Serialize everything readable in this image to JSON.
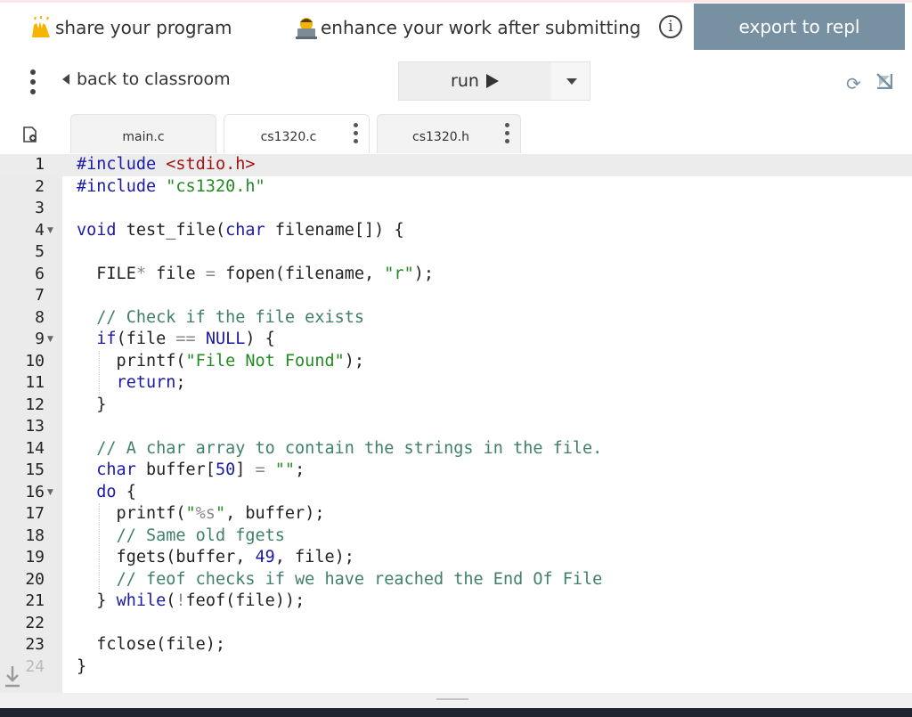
{
  "topbar": {
    "share_label": "share your program",
    "share_icon": "raising-hands-emoji",
    "enhance_label": "enhance your work after submitting",
    "enhance_icon": "person-with-laptop-emoji",
    "info_icon_glyph": "i",
    "export_label": "export to repl",
    "export_color": "#7791a3"
  },
  "toolbar": {
    "back_label": "back to classroom",
    "run_label": "run",
    "refresh_glyph": "⟳"
  },
  "tabs": [
    {
      "label": "main.c"
    },
    {
      "label": "cs1320.c"
    },
    {
      "label": "cs1320.h"
    }
  ],
  "editor": {
    "highlighted_line": 1,
    "lines": [
      {
        "n": "1",
        "fold": false
      },
      {
        "n": "2",
        "fold": false
      },
      {
        "n": "3",
        "fold": false
      },
      {
        "n": "4",
        "fold": true
      },
      {
        "n": "5",
        "fold": false
      },
      {
        "n": "6",
        "fold": false
      },
      {
        "n": "7",
        "fold": false
      },
      {
        "n": "8",
        "fold": false
      },
      {
        "n": "9",
        "fold": true
      },
      {
        "n": "10",
        "fold": false
      },
      {
        "n": "11",
        "fold": false
      },
      {
        "n": "12",
        "fold": false
      },
      {
        "n": "13",
        "fold": false
      },
      {
        "n": "14",
        "fold": false
      },
      {
        "n": "15",
        "fold": false
      },
      {
        "n": "16",
        "fold": true
      },
      {
        "n": "17",
        "fold": false
      },
      {
        "n": "18",
        "fold": false
      },
      {
        "n": "19",
        "fold": false
      },
      {
        "n": "20",
        "fold": false
      },
      {
        "n": "21",
        "fold": false
      },
      {
        "n": "22",
        "fold": false
      },
      {
        "n": "23",
        "fold": false
      },
      {
        "n": "24",
        "fold": false
      }
    ],
    "code": [
      [
        [
          "dir",
          "#include "
        ],
        [
          "str",
          "<stdio.h>"
        ]
      ],
      [
        [
          "dir",
          "#include "
        ],
        [
          "str",
          "\"cs1320.h\""
        ]
      ],
      [],
      [
        [
          "kw",
          "void"
        ],
        [
          "pl",
          " test_file("
        ],
        [
          "kw",
          "char"
        ],
        [
          "pl",
          " filename[]) {"
        ]
      ],
      [],
      [
        [
          "pl",
          "  FILE"
        ],
        [
          "op",
          "*"
        ],
        [
          "pl",
          " file "
        ],
        [
          "op",
          "="
        ],
        [
          "pl",
          " fopen(filename, "
        ],
        [
          "str",
          "\"r\""
        ],
        [
          "pl",
          ");"
        ]
      ],
      [],
      [
        [
          "pl",
          "  "
        ],
        [
          "cm",
          "// Check if the file exists"
        ]
      ],
      [
        [
          "pl",
          "  "
        ],
        [
          "kw",
          "if"
        ],
        [
          "pl",
          "(file "
        ],
        [
          "op",
          "=="
        ],
        [
          "pl",
          " "
        ],
        [
          "kw",
          "NULL"
        ],
        [
          "pl",
          ") {"
        ]
      ],
      [
        [
          "pl",
          "    printf("
        ],
        [
          "str",
          "\"File Not Found\""
        ],
        [
          "pl",
          ");"
        ]
      ],
      [
        [
          "pl",
          "    "
        ],
        [
          "kw",
          "return"
        ],
        [
          "pl",
          ";"
        ]
      ],
      [
        [
          "pl",
          "  }"
        ]
      ],
      [],
      [
        [
          "pl",
          "  "
        ],
        [
          "cm",
          "// A char array to contain the strings in the file."
        ]
      ],
      [
        [
          "pl",
          "  "
        ],
        [
          "kw",
          "char"
        ],
        [
          "pl",
          " buffer["
        ],
        [
          "num",
          "50"
        ],
        [
          "pl",
          "] "
        ],
        [
          "op",
          "="
        ],
        [
          "pl",
          " "
        ],
        [
          "str",
          "\"\""
        ],
        [
          "pl",
          ";"
        ]
      ],
      [
        [
          "pl",
          "  "
        ],
        [
          "kw",
          "do"
        ],
        [
          "pl",
          " {"
        ]
      ],
      [
        [
          "pl",
          "    printf("
        ],
        [
          "str",
          "\""
        ],
        [
          "op",
          "%s"
        ],
        [
          "str",
          "\""
        ],
        [
          "pl",
          ", buffer);"
        ]
      ],
      [
        [
          "pl",
          "    "
        ],
        [
          "cm",
          "// Same old fgets"
        ]
      ],
      [
        [
          "pl",
          "    fgets(buffer, "
        ],
        [
          "num",
          "49"
        ],
        [
          "pl",
          ", file);"
        ]
      ],
      [
        [
          "pl",
          "    "
        ],
        [
          "cm",
          "// feof checks if we have reached the End Of File"
        ]
      ],
      [
        [
          "pl",
          "  } "
        ],
        [
          "kw",
          "while"
        ],
        [
          "pl",
          "("
        ],
        [
          "op",
          "!"
        ],
        [
          "pl",
          "feof(file));"
        ]
      ],
      [],
      [
        [
          "pl",
          "  fclose(file);"
        ]
      ],
      [
        [
          "pl",
          "}"
        ]
      ]
    ],
    "colors": {
      "dir": "#1a1aa6",
      "str": "#a31515",
      "kw": "#1a1aa6",
      "pl": "#222222",
      "op": "#888888",
      "cm": "#40806a",
      "num": "#1a1aa6",
      "str2": "#228b22"
    }
  }
}
